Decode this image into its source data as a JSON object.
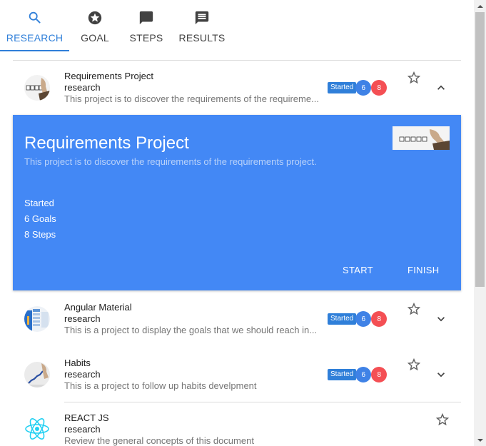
{
  "tabs": [
    {
      "label": "RESEARCH",
      "icon": "search-icon",
      "active": true
    },
    {
      "label": "GOAL",
      "icon": "star-circle-icon",
      "active": false
    },
    {
      "label": "STEPS",
      "icon": "comment-icon",
      "active": false
    },
    {
      "label": "RESULTS",
      "icon": "message-icon",
      "active": false
    }
  ],
  "projects": [
    {
      "title": "Requirements Project",
      "category": "research",
      "description": "This project is to discover the requirements of the requireme...",
      "status": "Started",
      "goals": "6",
      "steps": "8"
    },
    {
      "title": "Angular Material",
      "category": "research",
      "description": "This is a project to display the goals that we should reach in...",
      "status": "Started",
      "goals": "6",
      "steps": "8"
    },
    {
      "title": "Habits",
      "category": "research",
      "description": "This is a project to follow up habits develpment",
      "status": "Started",
      "goals": "6",
      "steps": "8"
    },
    {
      "title": "REACT JS",
      "category": "research",
      "description": "Review the general concepts of this document"
    }
  ],
  "expanded": {
    "title": "Requirements Project",
    "description": "This project is to discover the requirements of the requirements project.",
    "status": "Started",
    "goals": "6 Goals",
    "steps": "8 Steps",
    "start_label": "START",
    "finish_label": "FINISH"
  },
  "colors": {
    "accent": "#2f7fd9",
    "panel": "#4388f5",
    "goal_badge": "#3f82e6",
    "step_badge": "#f44f54"
  }
}
